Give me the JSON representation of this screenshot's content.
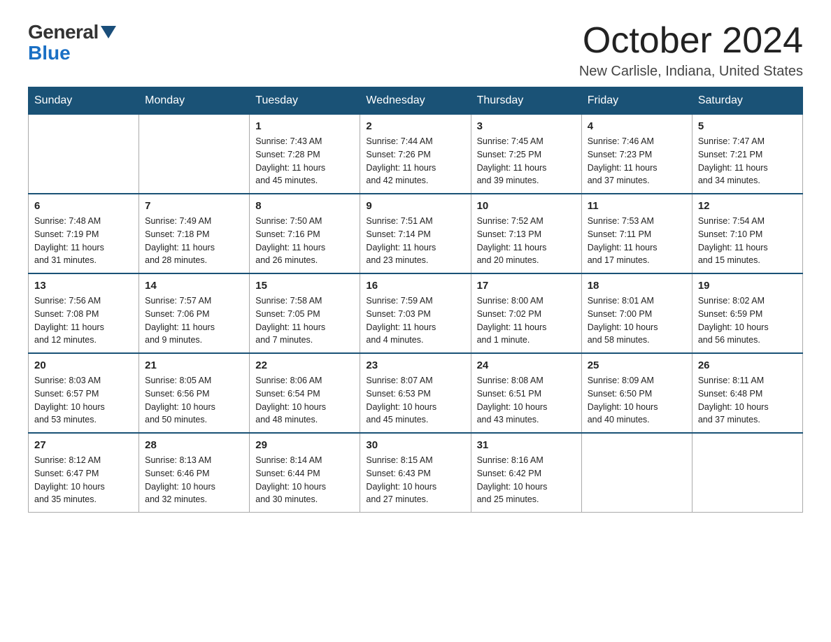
{
  "header": {
    "logo": {
      "general": "General",
      "blue": "Blue"
    },
    "title": "October 2024",
    "subtitle": "New Carlisle, Indiana, United States"
  },
  "calendar": {
    "days_of_week": [
      "Sunday",
      "Monday",
      "Tuesday",
      "Wednesday",
      "Thursday",
      "Friday",
      "Saturday"
    ],
    "weeks": [
      [
        {
          "day": "",
          "info": ""
        },
        {
          "day": "",
          "info": ""
        },
        {
          "day": "1",
          "info": "Sunrise: 7:43 AM\nSunset: 7:28 PM\nDaylight: 11 hours\nand 45 minutes."
        },
        {
          "day": "2",
          "info": "Sunrise: 7:44 AM\nSunset: 7:26 PM\nDaylight: 11 hours\nand 42 minutes."
        },
        {
          "day": "3",
          "info": "Sunrise: 7:45 AM\nSunset: 7:25 PM\nDaylight: 11 hours\nand 39 minutes."
        },
        {
          "day": "4",
          "info": "Sunrise: 7:46 AM\nSunset: 7:23 PM\nDaylight: 11 hours\nand 37 minutes."
        },
        {
          "day": "5",
          "info": "Sunrise: 7:47 AM\nSunset: 7:21 PM\nDaylight: 11 hours\nand 34 minutes."
        }
      ],
      [
        {
          "day": "6",
          "info": "Sunrise: 7:48 AM\nSunset: 7:19 PM\nDaylight: 11 hours\nand 31 minutes."
        },
        {
          "day": "7",
          "info": "Sunrise: 7:49 AM\nSunset: 7:18 PM\nDaylight: 11 hours\nand 28 minutes."
        },
        {
          "day": "8",
          "info": "Sunrise: 7:50 AM\nSunset: 7:16 PM\nDaylight: 11 hours\nand 26 minutes."
        },
        {
          "day": "9",
          "info": "Sunrise: 7:51 AM\nSunset: 7:14 PM\nDaylight: 11 hours\nand 23 minutes."
        },
        {
          "day": "10",
          "info": "Sunrise: 7:52 AM\nSunset: 7:13 PM\nDaylight: 11 hours\nand 20 minutes."
        },
        {
          "day": "11",
          "info": "Sunrise: 7:53 AM\nSunset: 7:11 PM\nDaylight: 11 hours\nand 17 minutes."
        },
        {
          "day": "12",
          "info": "Sunrise: 7:54 AM\nSunset: 7:10 PM\nDaylight: 11 hours\nand 15 minutes."
        }
      ],
      [
        {
          "day": "13",
          "info": "Sunrise: 7:56 AM\nSunset: 7:08 PM\nDaylight: 11 hours\nand 12 minutes."
        },
        {
          "day": "14",
          "info": "Sunrise: 7:57 AM\nSunset: 7:06 PM\nDaylight: 11 hours\nand 9 minutes."
        },
        {
          "day": "15",
          "info": "Sunrise: 7:58 AM\nSunset: 7:05 PM\nDaylight: 11 hours\nand 7 minutes."
        },
        {
          "day": "16",
          "info": "Sunrise: 7:59 AM\nSunset: 7:03 PM\nDaylight: 11 hours\nand 4 minutes."
        },
        {
          "day": "17",
          "info": "Sunrise: 8:00 AM\nSunset: 7:02 PM\nDaylight: 11 hours\nand 1 minute."
        },
        {
          "day": "18",
          "info": "Sunrise: 8:01 AM\nSunset: 7:00 PM\nDaylight: 10 hours\nand 58 minutes."
        },
        {
          "day": "19",
          "info": "Sunrise: 8:02 AM\nSunset: 6:59 PM\nDaylight: 10 hours\nand 56 minutes."
        }
      ],
      [
        {
          "day": "20",
          "info": "Sunrise: 8:03 AM\nSunset: 6:57 PM\nDaylight: 10 hours\nand 53 minutes."
        },
        {
          "day": "21",
          "info": "Sunrise: 8:05 AM\nSunset: 6:56 PM\nDaylight: 10 hours\nand 50 minutes."
        },
        {
          "day": "22",
          "info": "Sunrise: 8:06 AM\nSunset: 6:54 PM\nDaylight: 10 hours\nand 48 minutes."
        },
        {
          "day": "23",
          "info": "Sunrise: 8:07 AM\nSunset: 6:53 PM\nDaylight: 10 hours\nand 45 minutes."
        },
        {
          "day": "24",
          "info": "Sunrise: 8:08 AM\nSunset: 6:51 PM\nDaylight: 10 hours\nand 43 minutes."
        },
        {
          "day": "25",
          "info": "Sunrise: 8:09 AM\nSunset: 6:50 PM\nDaylight: 10 hours\nand 40 minutes."
        },
        {
          "day": "26",
          "info": "Sunrise: 8:11 AM\nSunset: 6:48 PM\nDaylight: 10 hours\nand 37 minutes."
        }
      ],
      [
        {
          "day": "27",
          "info": "Sunrise: 8:12 AM\nSunset: 6:47 PM\nDaylight: 10 hours\nand 35 minutes."
        },
        {
          "day": "28",
          "info": "Sunrise: 8:13 AM\nSunset: 6:46 PM\nDaylight: 10 hours\nand 32 minutes."
        },
        {
          "day": "29",
          "info": "Sunrise: 8:14 AM\nSunset: 6:44 PM\nDaylight: 10 hours\nand 30 minutes."
        },
        {
          "day": "30",
          "info": "Sunrise: 8:15 AM\nSunset: 6:43 PM\nDaylight: 10 hours\nand 27 minutes."
        },
        {
          "day": "31",
          "info": "Sunrise: 8:16 AM\nSunset: 6:42 PM\nDaylight: 10 hours\nand 25 minutes."
        },
        {
          "day": "",
          "info": ""
        },
        {
          "day": "",
          "info": ""
        }
      ]
    ]
  }
}
